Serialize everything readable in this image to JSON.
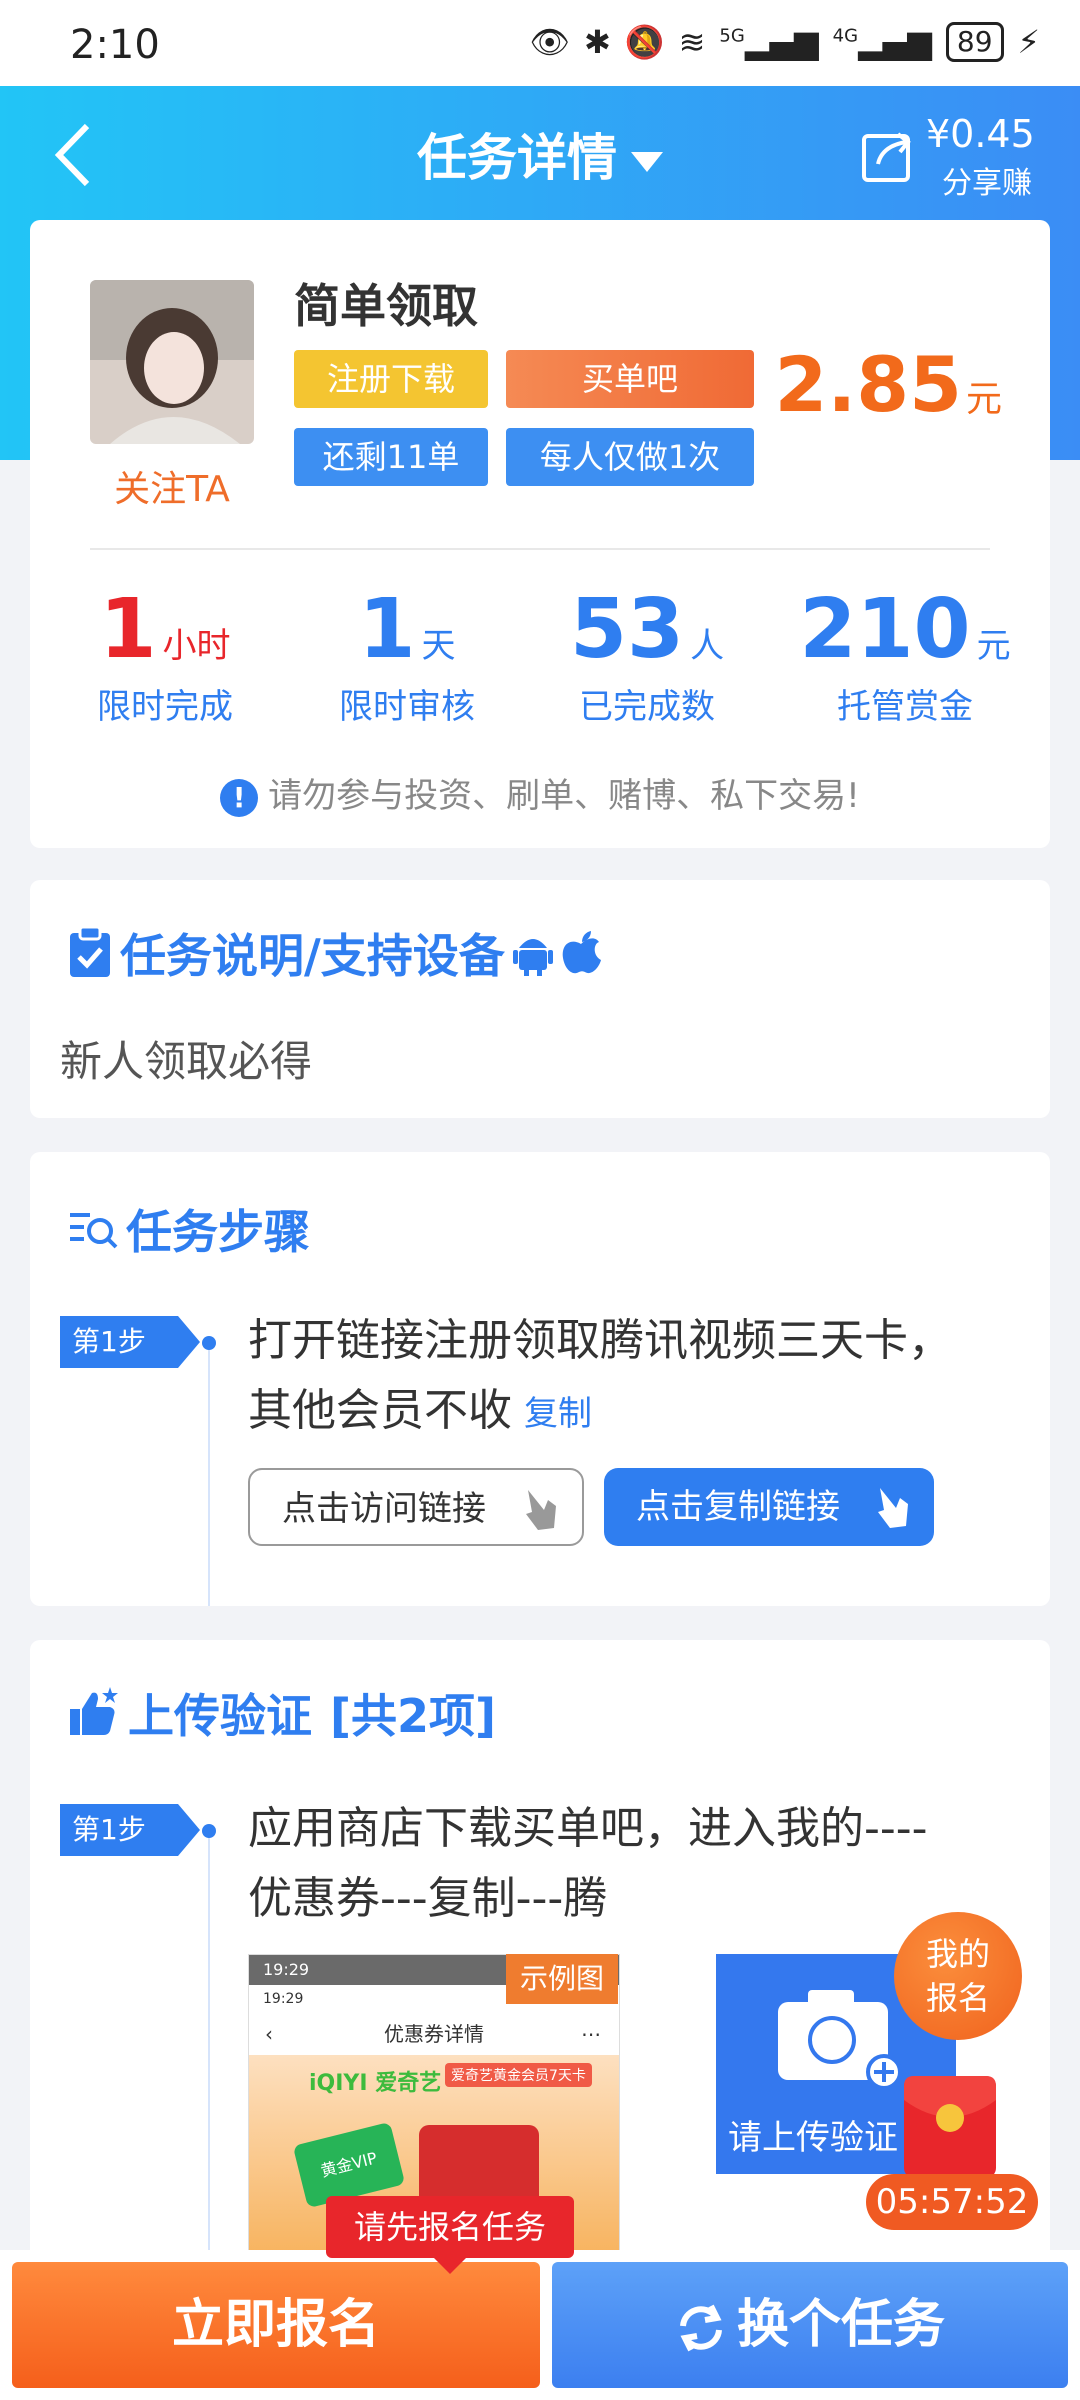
{
  "status": {
    "time": "2:10",
    "battery": "89",
    "net1": "5G",
    "net2": "4G"
  },
  "header": {
    "title": "任务详情",
    "share_amount": "¥0.45",
    "share_label": "分享赚"
  },
  "task": {
    "name": "简单领取",
    "follow": "关注TA",
    "tags": [
      "注册下载",
      "买单吧",
      "还剩11单",
      "每人仅做1次"
    ],
    "price": "2.85",
    "price_unit": "元",
    "stats": [
      {
        "value": "1",
        "unit": "小时",
        "label": "限时完成"
      },
      {
        "value": "1",
        "unit": "天",
        "label": "限时审核"
      },
      {
        "value": "53",
        "unit": "人",
        "label": "已完成数"
      },
      {
        "value": "210",
        "unit": "元",
        "label": "托管赏金"
      }
    ],
    "warning": "请勿参与投资、刷单、赌博、私下交易!"
  },
  "description": {
    "title": "任务说明/支持设备",
    "text": "新人领取必得"
  },
  "steps": {
    "title": "任务步骤",
    "step_label": "第1步",
    "text_line1": "打开链接注册领取腾讯视频三天卡，",
    "text_line2": "其他会员不收",
    "copy": "复制",
    "visit_btn": "点击访问链接",
    "copy_btn": "点击复制链接"
  },
  "upload": {
    "title": "上传验证",
    "count": "[共2项]",
    "step_label": "第1步",
    "text_line1": "应用商店下载买单吧，进入我的----",
    "text_line2": "优惠券---复制---腾",
    "example_tag": "示例图",
    "upload_label": "请上传验证",
    "shot": {
      "time": "19:29",
      "header": "优惠券详情",
      "brand": "iQIYI 爱奇艺",
      "promo": "爱奇艺黄金会员7天卡",
      "vip": "黄金VIP"
    }
  },
  "float": {
    "my_signup_line1": "我的",
    "my_signup_line2": "报名",
    "timer": "05:57:52"
  },
  "bottom": {
    "tooltip": "请先报名任务",
    "signup": "立即报名",
    "switch": "换个任务"
  }
}
